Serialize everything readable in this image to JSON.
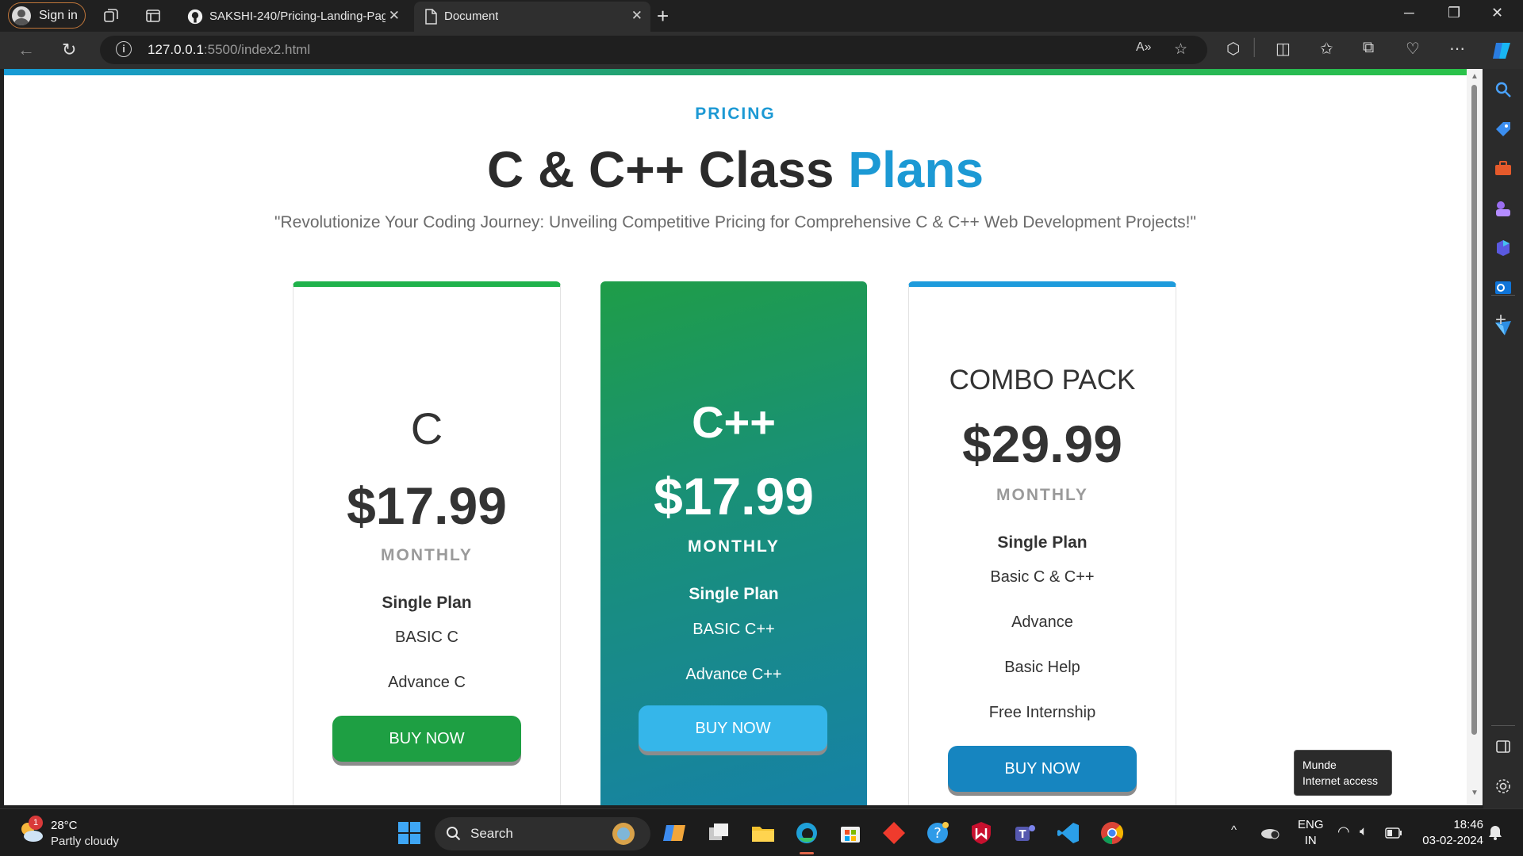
{
  "browser": {
    "signin_label": "Sign in",
    "tabs": [
      {
        "title": "SAKSHI-240/Pricing-Landing-Pag",
        "active": false
      },
      {
        "title": "Document",
        "active": true
      }
    ],
    "url_host": "127.0.0.1",
    "url_rest": ":5500/index2.html"
  },
  "page": {
    "eyebrow": "PRICING",
    "headline_main": "C & C++ Class ",
    "headline_accent": "Plans",
    "subtitle": "\"Revolutionize Your Coding Journey: Unveiling Competitive Pricing for Comprehensive C & C++ Web Development Projects!\"",
    "accent_color": "#1c99d4",
    "cards": [
      {
        "name": "C",
        "price": "$17.99",
        "period": "MONTHLY",
        "plan": "Single Plan",
        "features": [
          "BASIC C",
          "Advance C"
        ],
        "button": "BUY NOW"
      },
      {
        "name": "C++",
        "price": "$17.99",
        "period": "MONTHLY",
        "plan": "Single Plan",
        "features": [
          "BASIC C++",
          "Advance C++"
        ],
        "button": "BUY NOW"
      },
      {
        "name": "COMBO PACK",
        "price": "$29.99",
        "period": "MONTHLY",
        "plan": "Single Plan",
        "features": [
          "Basic C & C++",
          "Advance",
          "Basic Help",
          "Free Internship"
        ],
        "button": "BUY NOW"
      }
    ]
  },
  "tooltip": {
    "line1": "Munde",
    "line2": "Internet access"
  },
  "taskbar": {
    "weather_temp": "28°C",
    "weather_cond": "Partly cloudy",
    "weather_badge": "1",
    "search_label": "Search",
    "lang_1": "ENG",
    "lang_2": "IN",
    "time": "18:46",
    "date": "03-02-2024"
  }
}
